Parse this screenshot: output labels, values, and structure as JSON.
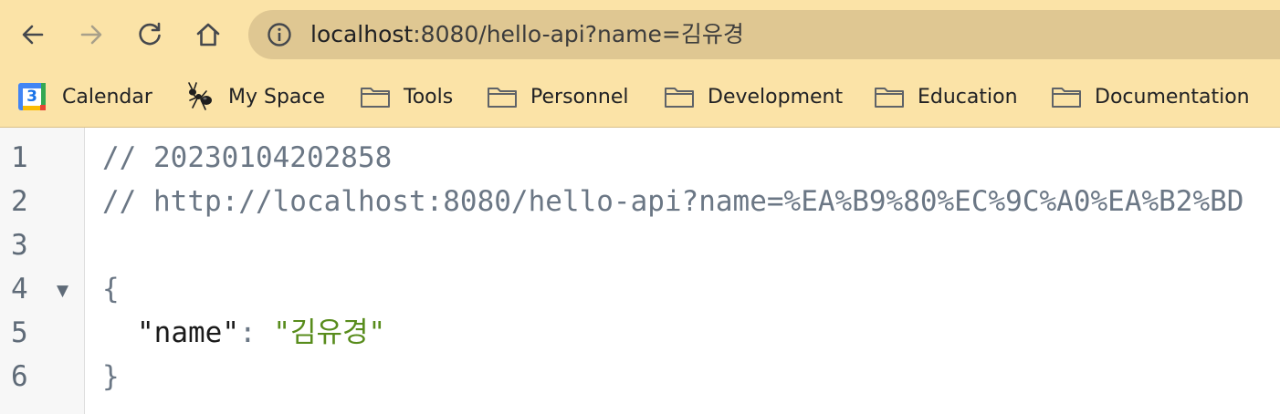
{
  "toolbar": {
    "back_icon": "arrow-left-icon",
    "forward_icon": "arrow-right-icon",
    "reload_icon": "reload-icon",
    "home_icon": "home-icon",
    "info_icon": "info-circle-icon",
    "url_domain": "localhost",
    "url_path": ":8080/hello-api?name=김유경"
  },
  "bookmarks": [
    {
      "label": "Calendar",
      "icon": "google-calendar-icon"
    },
    {
      "label": "My Space",
      "icon": "ant-icon"
    },
    {
      "label": "Tools",
      "icon": "folder-icon"
    },
    {
      "label": "Personnel",
      "icon": "folder-icon"
    },
    {
      "label": "Development",
      "icon": "folder-icon"
    },
    {
      "label": "Education",
      "icon": "folder-icon"
    },
    {
      "label": "Documentation",
      "icon": "folder-icon"
    }
  ],
  "calendar_day": "3",
  "editor": {
    "line_numbers": [
      "1",
      "2",
      "3",
      "4",
      "5",
      "6"
    ],
    "comment_timestamp": "// 20230104202858",
    "comment_url": "// http://localhost:8080/hello-api?name=%EA%B9%80%EC%9C%A0%EA%B2%BD",
    "open_brace": "{",
    "json_key": "\"name\"",
    "colon": ":",
    "json_value": "\"김유경\"",
    "close_brace": "}",
    "fold_icon": "fold-triangle-icon"
  },
  "colors": {
    "chrome_background": "#fbe3a7",
    "omnibox_background": "#dfc792",
    "string_color": "#588c1c",
    "comment_color": "#6b7785"
  }
}
